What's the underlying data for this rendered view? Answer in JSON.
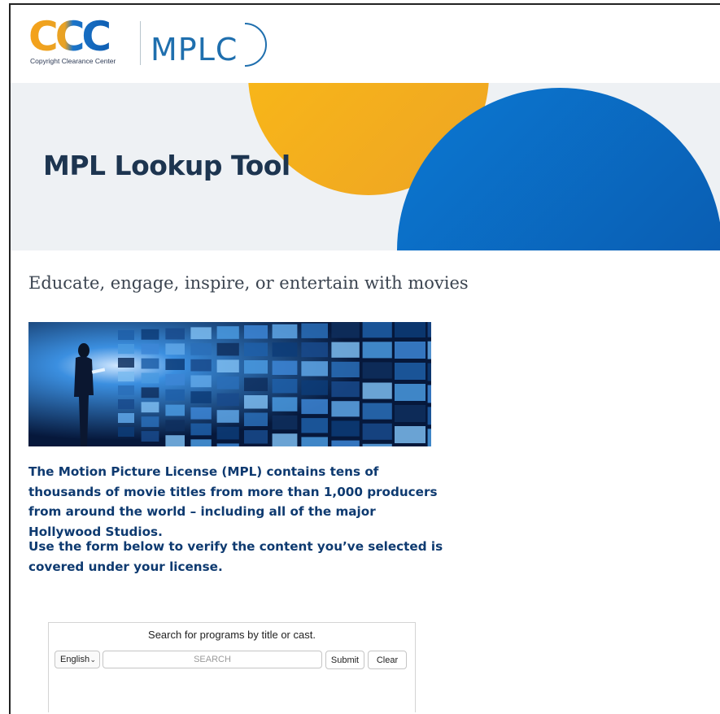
{
  "header": {
    "logo_ccc": "CCC",
    "logo_ccc_tagline": "Copyright Clearance Center",
    "logo_mplc": "MPLC"
  },
  "banner": {
    "title": "MPL Lookup Tool"
  },
  "main": {
    "tagline": "Educate, engage, inspire, or entertain with movies",
    "paragraph_1": "The Motion Picture License (MPL) contains tens of thousands of movie titles from more than 1,000 producers from around the world – including all of the major Hollywood Studios.",
    "paragraph_2": "Use the form below to verify the content you’ve selected is covered under your license."
  },
  "search": {
    "heading": "Search for programs by title or cast.",
    "language_selected": "English",
    "placeholder": "SEARCH",
    "value": "",
    "submit_label": "Submit",
    "clear_label": "Clear"
  },
  "colors": {
    "banner_bg": "#eef1f4",
    "yellow_circle": "#f6b41a",
    "blue_circle": "#0a6cc4",
    "title_text": "#1d3550",
    "body_text": "#0e3a70"
  }
}
